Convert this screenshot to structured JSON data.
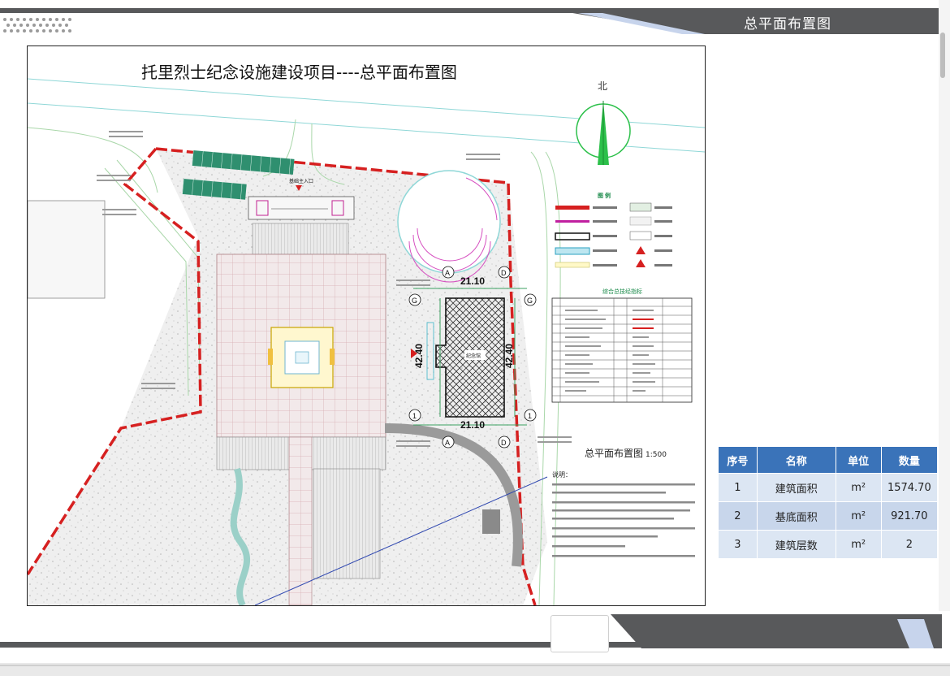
{
  "header": {
    "title": "总平面布置图",
    "colors": {
      "band": "#58595b",
      "accent": "#c7d4ec"
    }
  },
  "plan": {
    "title": "托里烈士纪念设施建设项目----总平面布置图",
    "subtitle": "总平面布置图",
    "scale": "1:500",
    "north_label": "北",
    "gate_label": "基础主入口",
    "building_label": "纪念馆",
    "dimensions": {
      "width_top": "21.10",
      "width_bottom": "21.10",
      "height_left": "42.40",
      "height_right": "42.40"
    },
    "grid_markers": {
      "a": "A",
      "d": "D",
      "g": "G",
      "one": "1"
    },
    "legend_title": "图 例",
    "stats_title": "综合总技经指标",
    "notes_title": "说明："
  },
  "table": {
    "headers": [
      "序号",
      "名称",
      "单位",
      "数量"
    ],
    "rows": [
      {
        "no": "1",
        "name": "建筑面积",
        "unit": "m²",
        "value": "1574.70"
      },
      {
        "no": "2",
        "name": "基底面积",
        "unit": "m²",
        "value": "921.70"
      },
      {
        "no": "3",
        "name": "建筑层数",
        "unit": "m²",
        "value": "2"
      }
    ]
  }
}
